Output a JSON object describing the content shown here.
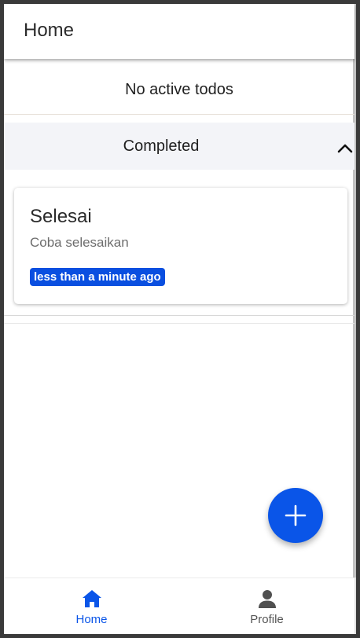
{
  "appbar": {
    "title": "Home"
  },
  "active": {
    "empty_text": "No active todos"
  },
  "completed": {
    "title": "Completed",
    "items": [
      {
        "title": "Selesai",
        "description": "Coba selesaikan",
        "time": "less than a minute ago"
      }
    ]
  },
  "fab": {
    "icon": "plus-icon"
  },
  "bottom_nav": {
    "items": [
      {
        "label": "Home",
        "icon": "home-icon",
        "active": true
      },
      {
        "label": "Profile",
        "icon": "person-icon",
        "active": false
      }
    ]
  },
  "colors": {
    "accent": "#0a55e8",
    "badge": "#0a4fe0",
    "section_bg": "#f3f4f8"
  }
}
